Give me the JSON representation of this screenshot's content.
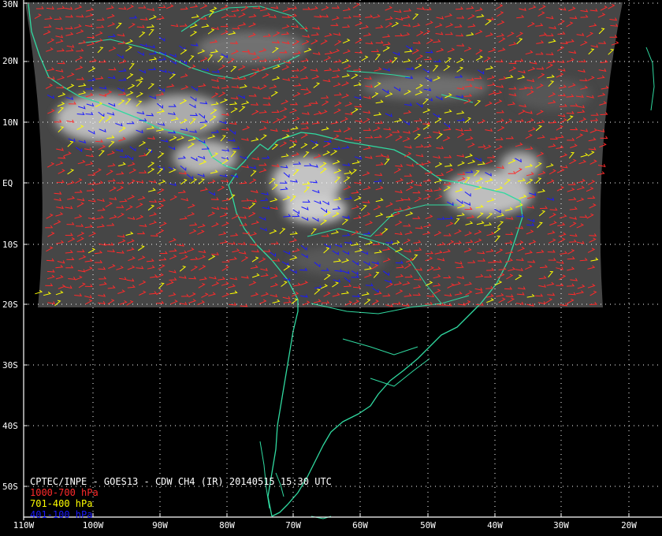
{
  "caption": "CPTEC/INPE - GOES13 - CDW CH4 (IR) 20140515 15:30 UTC",
  "layers": [
    {
      "label": "1000-700 hPa",
      "color": "#ff2a2a"
    },
    {
      "label": "701-400 hPa",
      "color": "#ffff00"
    },
    {
      "label": "401-100 hPa",
      "color": "#1a1aff"
    }
  ],
  "lat_labels": [
    "30N",
    "20N",
    "10N",
    "EQ",
    "10S",
    "20S",
    "30S",
    "40S",
    "50S"
  ],
  "lon_labels": [
    "110W",
    "100W",
    "90W",
    "80W",
    "70W",
    "60W",
    "50W",
    "40W",
    "30W",
    "20W"
  ],
  "colors": {
    "background": "#000000",
    "coastline": "#30d9a0",
    "grid": "#ffffff",
    "satellite_gray": "#4a4a4a",
    "clouds": "#dcdcdc"
  }
}
